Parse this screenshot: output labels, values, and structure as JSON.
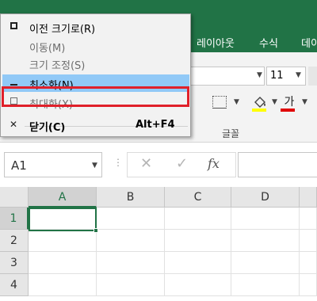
{
  "ribbon": {
    "tabs": [
      {
        "label": "레이아웃"
      },
      {
        "label": "수식"
      },
      {
        "label": "데이"
      }
    ],
    "font_size": "11",
    "font_color_glyph": "가",
    "group_label": "글꼴",
    "group_label_left": "",
    "colors": {
      "brand": "#217346",
      "fill_color": "#ffff00",
      "font_color": "#e00000"
    }
  },
  "formula_bar": {
    "name_box": "A1",
    "fx_label": "fx",
    "cancel_glyph": "✕",
    "enter_glyph": "✓",
    "sep": "⋮"
  },
  "grid": {
    "columns": [
      "A",
      "B",
      "C",
      "D"
    ],
    "rows": [
      "1",
      "2",
      "3",
      "4"
    ],
    "active_cell": "A1"
  },
  "system_menu": {
    "items": [
      {
        "label": "이전 크기로(R)",
        "icon": "restore-icon",
        "enabled": true
      },
      {
        "label": "이동(M)",
        "icon": "",
        "enabled": false
      },
      {
        "label": "크기 조정(S)",
        "icon": "",
        "enabled": false
      },
      {
        "label": "최소화(N)",
        "icon": "minimize-icon",
        "enabled": true,
        "highlighted": true
      },
      {
        "label": "최대화(X)",
        "icon": "maximize-icon",
        "enabled": false
      },
      {
        "label": "닫기(C)",
        "icon": "close-icon",
        "enabled": true,
        "shortcut": "Alt+F4"
      }
    ],
    "close_glyph": "✕"
  }
}
